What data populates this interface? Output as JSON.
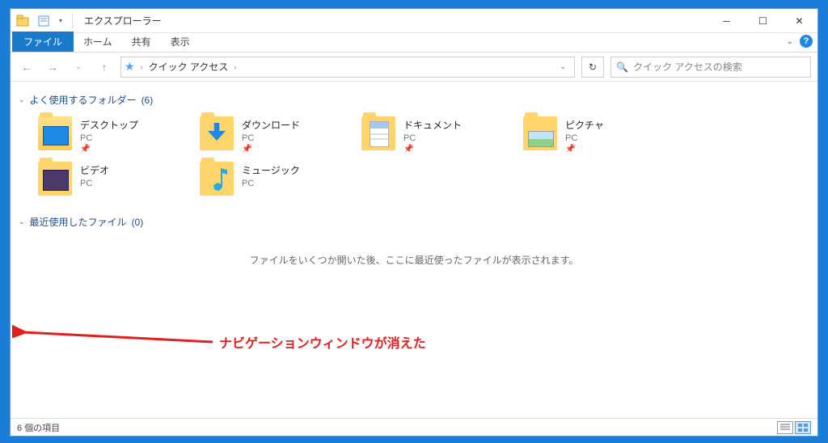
{
  "title": "エクスプローラー",
  "ribbon": {
    "file": "ファイル",
    "home": "ホーム",
    "share": "共有",
    "view": "表示"
  },
  "breadcrumb": {
    "location": "クイック アクセス"
  },
  "search": {
    "placeholder": "クイック アクセスの検索"
  },
  "groups": {
    "frequent": {
      "label": "よく使用するフォルダー",
      "count": "(6)"
    },
    "recent": {
      "label": "最近使用したファイル",
      "count": "(0)"
    }
  },
  "folders": [
    {
      "name": "デスクトップ",
      "sub": "PC",
      "pinned": true,
      "iconClass": "desktop"
    },
    {
      "name": "ダウンロード",
      "sub": "PC",
      "pinned": true,
      "iconClass": "download"
    },
    {
      "name": "ドキュメント",
      "sub": "PC",
      "pinned": true,
      "iconClass": "doc"
    },
    {
      "name": "ピクチャ",
      "sub": "PC",
      "pinned": true,
      "iconClass": "pic"
    },
    {
      "name": "ビデオ",
      "sub": "PC",
      "pinned": false,
      "iconClass": "vid"
    },
    {
      "name": "ミュージック",
      "sub": "PC",
      "pinned": false,
      "iconClass": "music"
    }
  ],
  "empty_recent": "ファイルをいくつか開いた後、ここに最近使ったファイルが表示されます。",
  "annotation": "ナビゲーションウィンドウが消えた",
  "status": {
    "count": "6 個の項目"
  }
}
